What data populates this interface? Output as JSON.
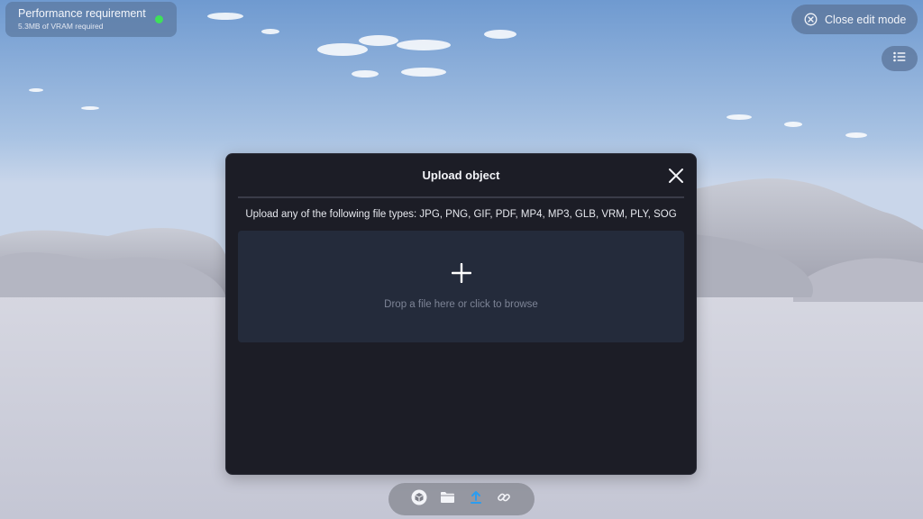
{
  "performance": {
    "title": "Performance requirement",
    "subtitle": "5.3MB of VRAM required",
    "status_color": "#3ee05a"
  },
  "header": {
    "close_edit_label": "Close edit mode",
    "close_edit_icon": "circle-x-icon",
    "list_icon": "list-icon"
  },
  "modal": {
    "title": "Upload object",
    "close_icon": "close-icon",
    "file_types_text": "Upload any of the following file types: JPG, PNG, GIF, PDF, MP4, MP3, GLB, VRM, PLY, SOG",
    "dropzone_icon": "plus-icon",
    "dropzone_text": "Drop a file here or click to browse"
  },
  "toolbar": {
    "items": [
      {
        "icon": "cube-icon",
        "active": false
      },
      {
        "icon": "folder-icon",
        "active": false
      },
      {
        "icon": "upload-icon",
        "active": true
      },
      {
        "icon": "link-icon",
        "active": false
      }
    ],
    "active_color": "#2b9df0"
  }
}
